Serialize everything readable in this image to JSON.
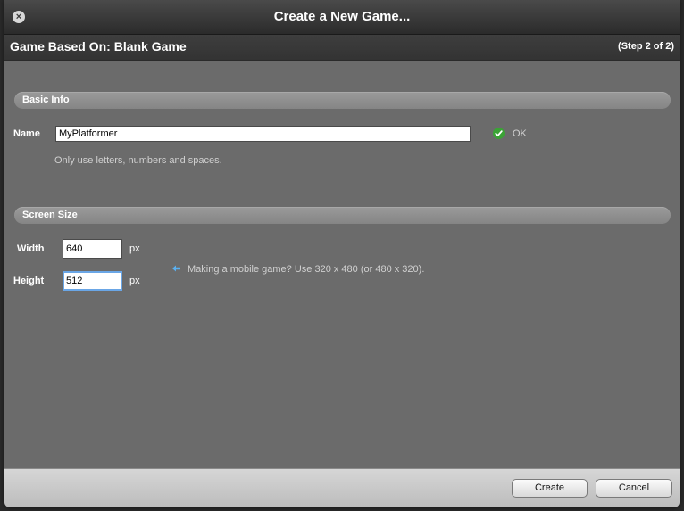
{
  "window": {
    "title": "Create a New Game...",
    "close_glyph": "×"
  },
  "header": {
    "title": "Game Based On: Blank Game",
    "step": "(Step 2 of 2)"
  },
  "basic_info": {
    "section_label": "Basic Info",
    "name_label": "Name",
    "name_value": "MyPlatformer",
    "status_icon": "check-circle-icon",
    "status_text": "OK",
    "hint": "Only use letters, numbers and spaces."
  },
  "screen_size": {
    "section_label": "Screen Size",
    "width_label": "Width",
    "width_value": "640",
    "width_unit": "px",
    "height_label": "Height",
    "height_value": "512",
    "height_unit": "px",
    "mobile_hint_icon": "left-arrow-icon",
    "mobile_hint": "Making a mobile game? Use 320 x 480 (or 480 x 320)."
  },
  "footer": {
    "create_label": "Create",
    "cancel_label": "Cancel"
  },
  "colors": {
    "dialog_bg": "#6b6b6b",
    "ok_green": "#3aa335",
    "arrow_blue": "#5ab0f0",
    "focus_ring": "#6aa6e6"
  }
}
